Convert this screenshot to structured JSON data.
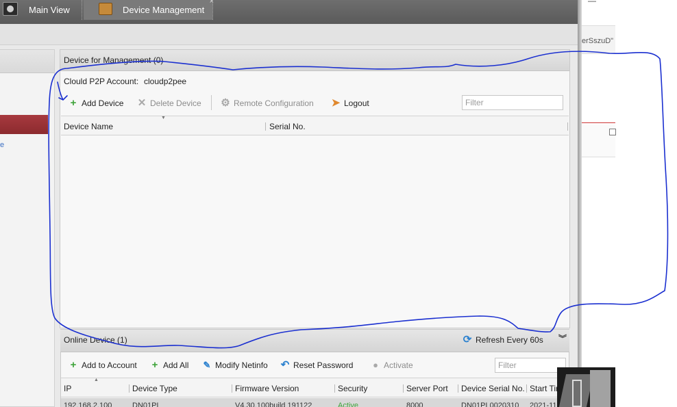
{
  "tabs": {
    "main_view": "Main View",
    "device_management": "Device Management",
    "close_glyph": "×"
  },
  "device_panel": {
    "title": "Device for Management (0)",
    "cloud_label": "Clould P2P Account:",
    "cloud_account": "cloudp2pee",
    "toolbar": {
      "add_device": "Add Device",
      "delete_device": "Delete Device",
      "remote_configuration": "Remote Configuration",
      "logout": "Logout",
      "filter_placeholder": "Filter"
    },
    "columns": [
      "Device Name",
      "Serial No."
    ]
  },
  "online_panel": {
    "title": "Online Device (1)",
    "refresh": "Refresh Every 60s",
    "toolbar": {
      "add_to_account": "Add to Account",
      "add_all": "Add All",
      "modify_netinfo": "Modify Netinfo",
      "reset_password": "Reset Password",
      "activate": "Activate",
      "filter_placeholder": "Filter"
    },
    "columns": [
      "IP",
      "Device Type",
      "Firmware Version",
      "Security",
      "Server Port",
      "Device Serial No.",
      "Start Tir"
    ],
    "rows": [
      {
        "ip": "192.168.2.100",
        "device_type": "DN01PL",
        "firmware": "V4.30.100build 191122",
        "security": "Active",
        "server_port": "8000",
        "serial": "DN01PL0020310",
        "start_time": "2021-11"
      }
    ]
  },
  "background_window": {
    "code_text": "erSszuD\"",
    "minimize_glyph": "—"
  },
  "icons": {
    "add": "plus-icon",
    "delete": "x-icon",
    "remote_config": "gear-icon",
    "logout": "logout-arrow-icon",
    "refresh": "refresh-icon",
    "modify": "edit-icon",
    "reset": "undo-icon",
    "activate": "bulb-icon",
    "collapse": "double-chevron-down-icon"
  },
  "colors": {
    "annotation_ink": "#1a2fd0",
    "selection_red": "#9b3035",
    "add_green": "#3ea33a"
  }
}
